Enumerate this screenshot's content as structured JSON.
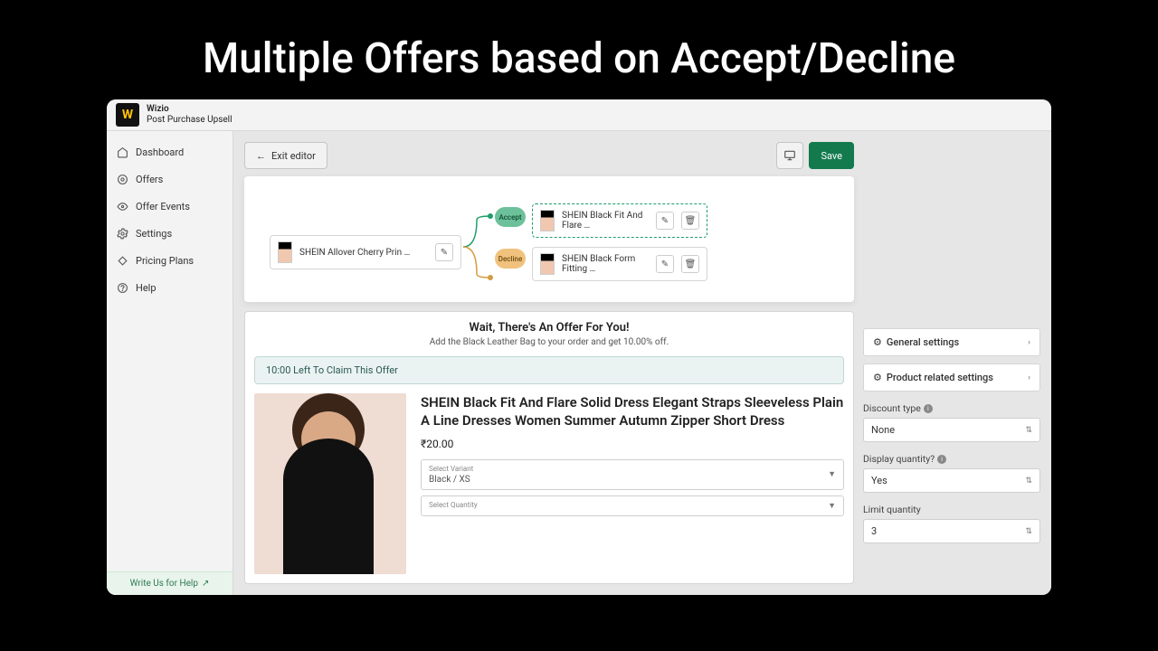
{
  "hero": {
    "title": "Multiple Offers based on Accept/Decline"
  },
  "app": {
    "name": "Wizio",
    "subtitle": "Post Purchase Upsell",
    "logo_letter": "W"
  },
  "sidebar": {
    "items": [
      {
        "label": "Dashboard",
        "icon": "home-icon"
      },
      {
        "label": "Offers",
        "icon": "tag-icon"
      },
      {
        "label": "Offer Events",
        "icon": "eye-icon"
      },
      {
        "label": "Settings",
        "icon": "gear-icon"
      },
      {
        "label": "Pricing Plans",
        "icon": "price-icon"
      },
      {
        "label": "Help",
        "icon": "help-icon"
      }
    ],
    "write_us": "Write Us for Help"
  },
  "toolbar": {
    "exit": "Exit editor",
    "save": "Save"
  },
  "flow": {
    "initial": "SHEIN Allover Cherry Prin …",
    "accept_label": "Accept",
    "decline_label": "Decline",
    "accept_product": "SHEIN Black Fit And Flare …",
    "decline_product": "SHEIN Black Form Fitting …"
  },
  "offer": {
    "headline": "Wait, There's An Offer For You!",
    "sub": "Add the Black Leather Bag to your order and get 10.00% off.",
    "timer": "10:00 Left To Claim This Offer",
    "product_title": "SHEIN Black Fit And Flare Solid Dress Elegant Straps Sleeveless Plain A Line Dresses Women Summer Autumn Zipper Short Dress",
    "price": "₹20.00",
    "variant_label": "Select Variant",
    "variant_value": "Black / XS",
    "qty_label": "Select Quantity"
  },
  "settings": {
    "general": "General settings",
    "product": "Product related settings",
    "discount_type_label": "Discount type",
    "discount_type_value": "None",
    "display_qty_label": "Display quantity?",
    "display_qty_value": "Yes",
    "limit_qty_label": "Limit quantity",
    "limit_qty_value": "3"
  }
}
